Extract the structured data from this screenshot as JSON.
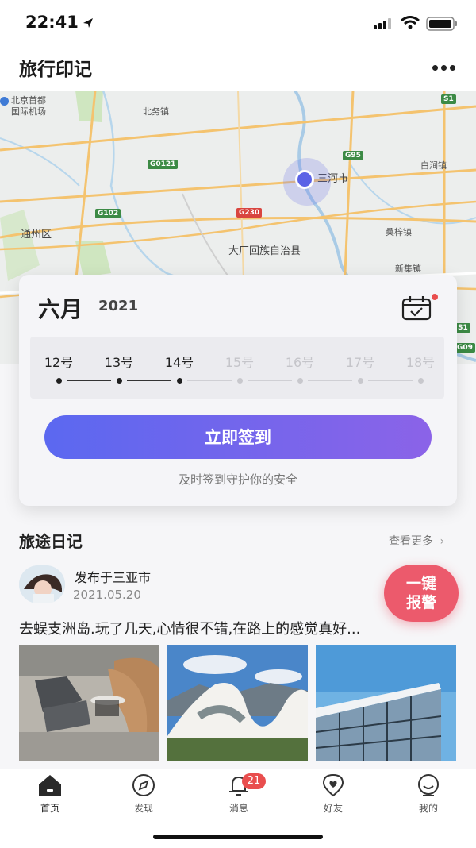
{
  "status_bar": {
    "time": "22:41"
  },
  "header": {
    "title": "旅行印记"
  },
  "map": {
    "labels": {
      "airport": "北京首都",
      "airport2": "国际机场",
      "beiwu": "北务镇",
      "sanhe": "三河市",
      "baijian": "白涧镇",
      "tongzhou": "通州区",
      "sangzi": "桑梓镇",
      "dachang": "大厂回族自治县",
      "xinji": "新集镇"
    },
    "roads": {
      "g0121": "G0121",
      "g102": "G102",
      "g230": "G230",
      "g95": "G95",
      "s1": "S1",
      "s1b": "S1",
      "g09": "G09"
    }
  },
  "checkin": {
    "month": "六月",
    "year": "2021",
    "dates": [
      {
        "label": "12号",
        "active": true
      },
      {
        "label": "13号",
        "active": true
      },
      {
        "label": "14号",
        "active": true
      },
      {
        "label": "15号",
        "active": false
      },
      {
        "label": "16号",
        "active": false
      },
      {
        "label": "17号",
        "active": false
      },
      {
        "label": "18号",
        "active": false
      }
    ],
    "button": "立即签到",
    "hint": "及时签到守护你的安全"
  },
  "diary": {
    "title": "旅途日记",
    "more": "查看更多",
    "post": {
      "location": "发布于三亚市",
      "date": "2021.05.20",
      "text": "去蜈支洲岛.玩了几天,心情很不错,在路上的感觉真好..."
    }
  },
  "sos": {
    "line1": "一键",
    "line2": "报警"
  },
  "tabs": [
    {
      "label": "首页",
      "active": true
    },
    {
      "label": "发现",
      "active": false
    },
    {
      "label": "消息",
      "active": false,
      "badge": "21"
    },
    {
      "label": "好友",
      "active": false
    },
    {
      "label": "我的",
      "active": false
    }
  ],
  "colors": {
    "accent_start": "#5b68f0",
    "accent_end": "#8b63e8",
    "sos": "#ec5a6c",
    "badge": "#e94e4e"
  }
}
